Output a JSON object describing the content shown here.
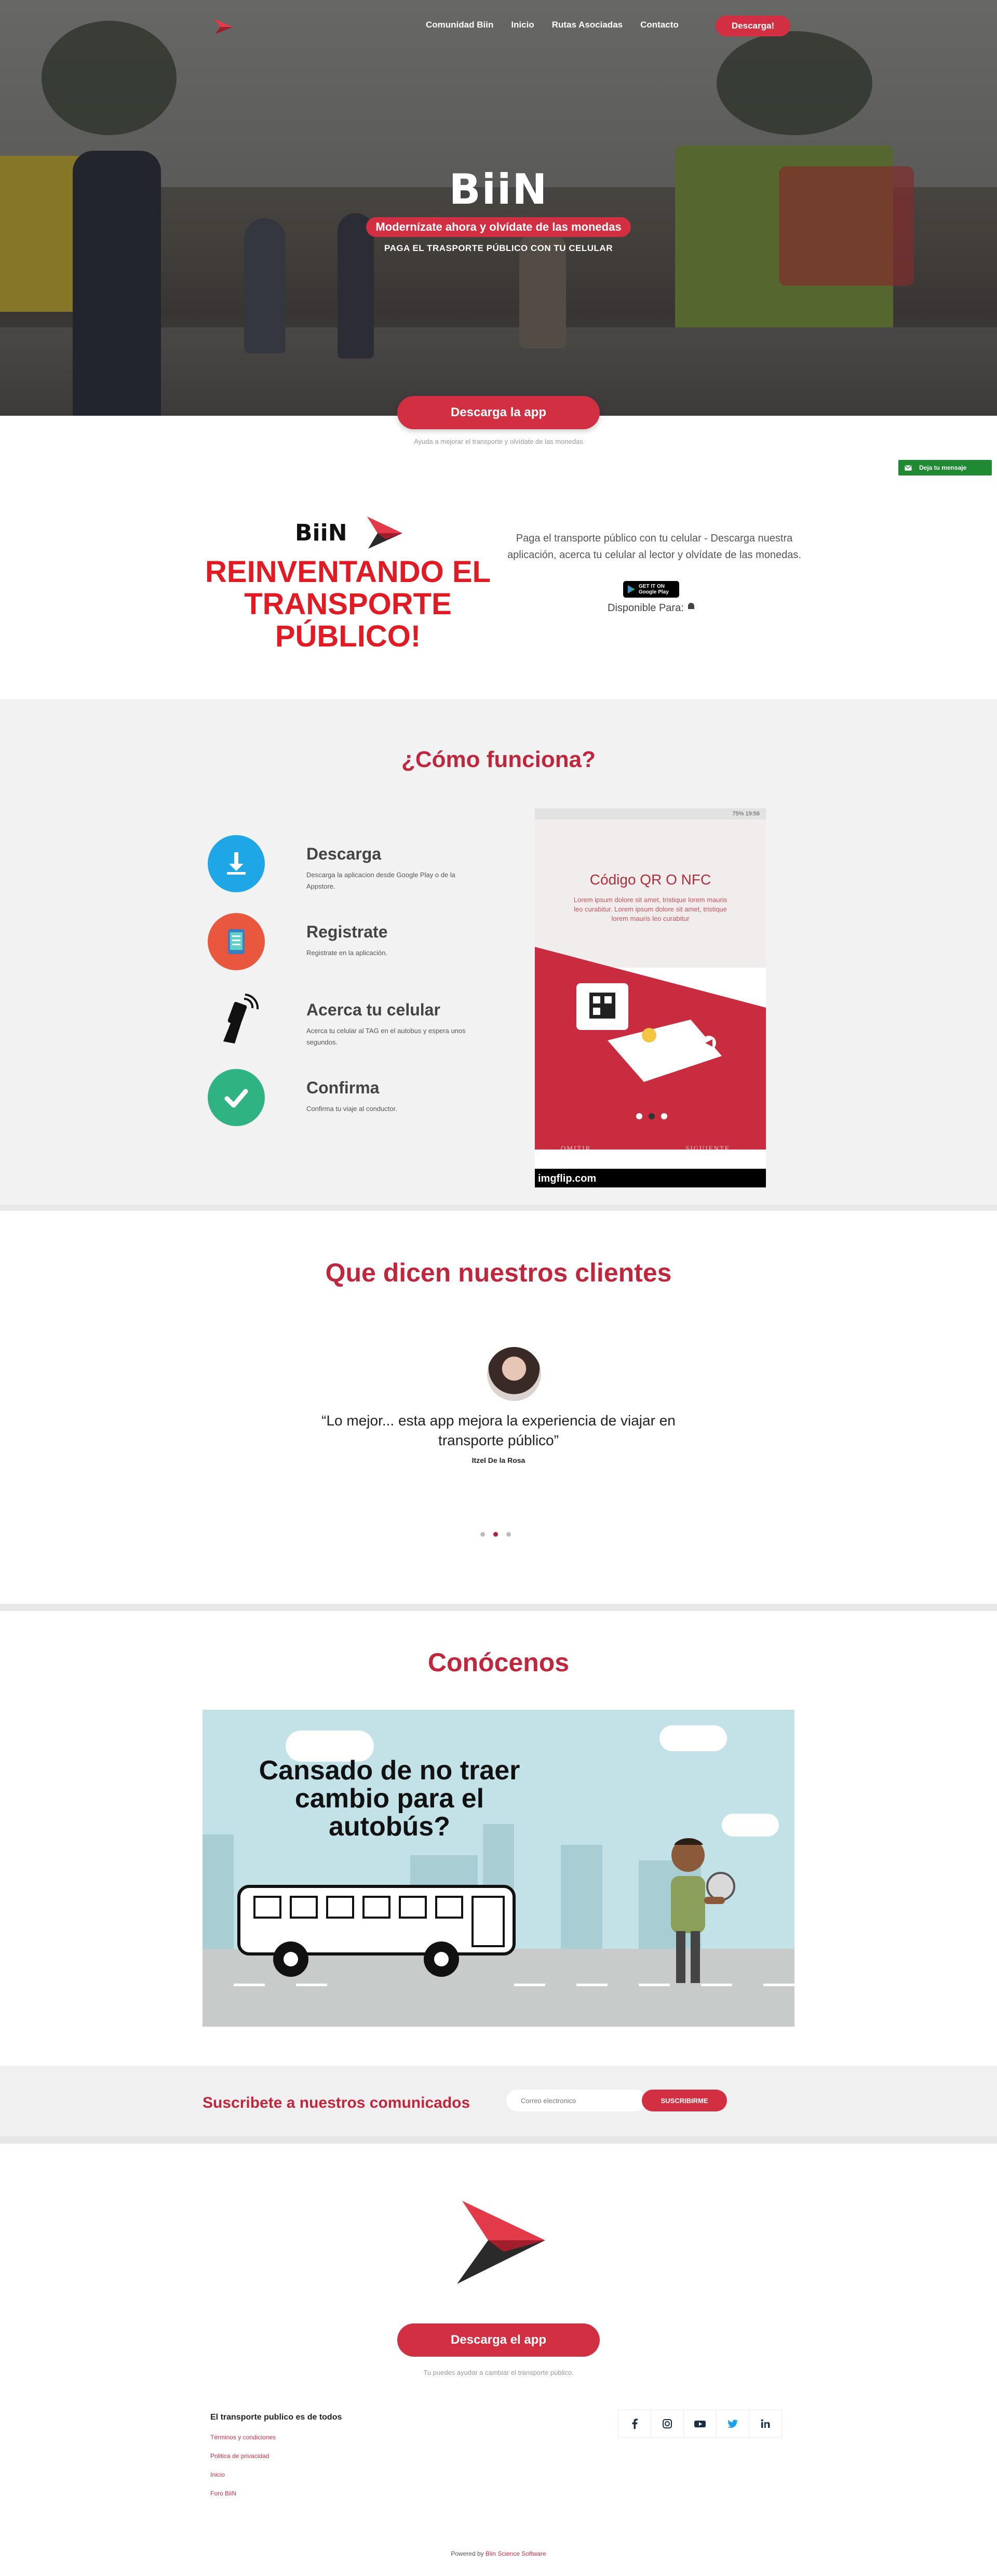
{
  "nav": {
    "items": [
      "Comunidad Biin",
      "Inicio",
      "Rutas Asociadas",
      "Contacto"
    ],
    "download_label": "Descarga!"
  },
  "hero": {
    "title": "BiiN",
    "tagline": "Modernízate ahora y olvídate de las monedas",
    "subtitle": "PAGA EL TRASPORTE PÚBLICO CON TU CELULAR"
  },
  "cta": {
    "label": "Descarga la app",
    "note": "Ayuda a mejorar el transporte y olvídate de las monedas"
  },
  "message_widget": "Deja tu mensaje",
  "intro": {
    "brand": "BiiN",
    "headline": "REINVENTANDO EL TRANSPORTE PÚBLICO!",
    "description": "Paga el transporte público con tu celular - Descarga nuestra aplicación, acerca tu celular al lector y olvídate de las monedas.",
    "store_badge_top": "GET IT ON",
    "store_badge": "Google Play",
    "available": "Disponible Para:"
  },
  "how": {
    "title": "¿Cómo funciona?",
    "steps": [
      {
        "title": "Descarga",
        "text": "Descarga la aplicacion desde Google Play o de la Appstore."
      },
      {
        "title": "Registrate",
        "text": "Registrate en la aplicación."
      },
      {
        "title": "Acerca tu celular",
        "text": "Acerca tu celular al TAG en el autobus y espera unos segundos."
      },
      {
        "title": "Confirma",
        "text": "Confirma tu viaje al conductor."
      }
    ],
    "phone": {
      "status": "75% 19:56",
      "title": "Código QR O NFC",
      "body": "Lorem ipsum dolore sit amet, tristique lorem mauris leo curabitur. Lorem ipsum dolore sit amet, tristique lorem mauris leo curabitur",
      "left": "OMITIR",
      "right": "SIGUIENTE",
      "watermark": "imgflip.com"
    }
  },
  "clients": {
    "title": "Que dicen nuestros clientes",
    "quote": "“Lo mejor... esta app mejora la experiencia de viajar en transporte público”",
    "author": "Itzel De la Rosa",
    "active_dot": 1
  },
  "about": {
    "title": "Conócenos",
    "video_text": "Cansado de no traer cambio para el autobús?"
  },
  "subscribe": {
    "title": "Suscribete a nuestros comunicados",
    "placeholder": "Correo electronico",
    "button": "SUSCRIBIRME"
  },
  "footer": {
    "cta": "Descarga el app",
    "note": "Tu puedes ayudar a cambiar el transporte público.",
    "heading": "El transporte publico es de todos",
    "links": [
      "Términos y condiciones",
      "Politica de privacidad",
      "Inicio",
      "Foro BiiN"
    ],
    "social": [
      "f",
      "ig",
      "yt",
      "tw",
      "in"
    ],
    "powered_prefix": "Powered by",
    "powered_link": "Biin Science Software",
    "colors": {
      "accent": "#d23042",
      "heading": "#c0273d",
      "headline_red": "#e01b24"
    }
  }
}
